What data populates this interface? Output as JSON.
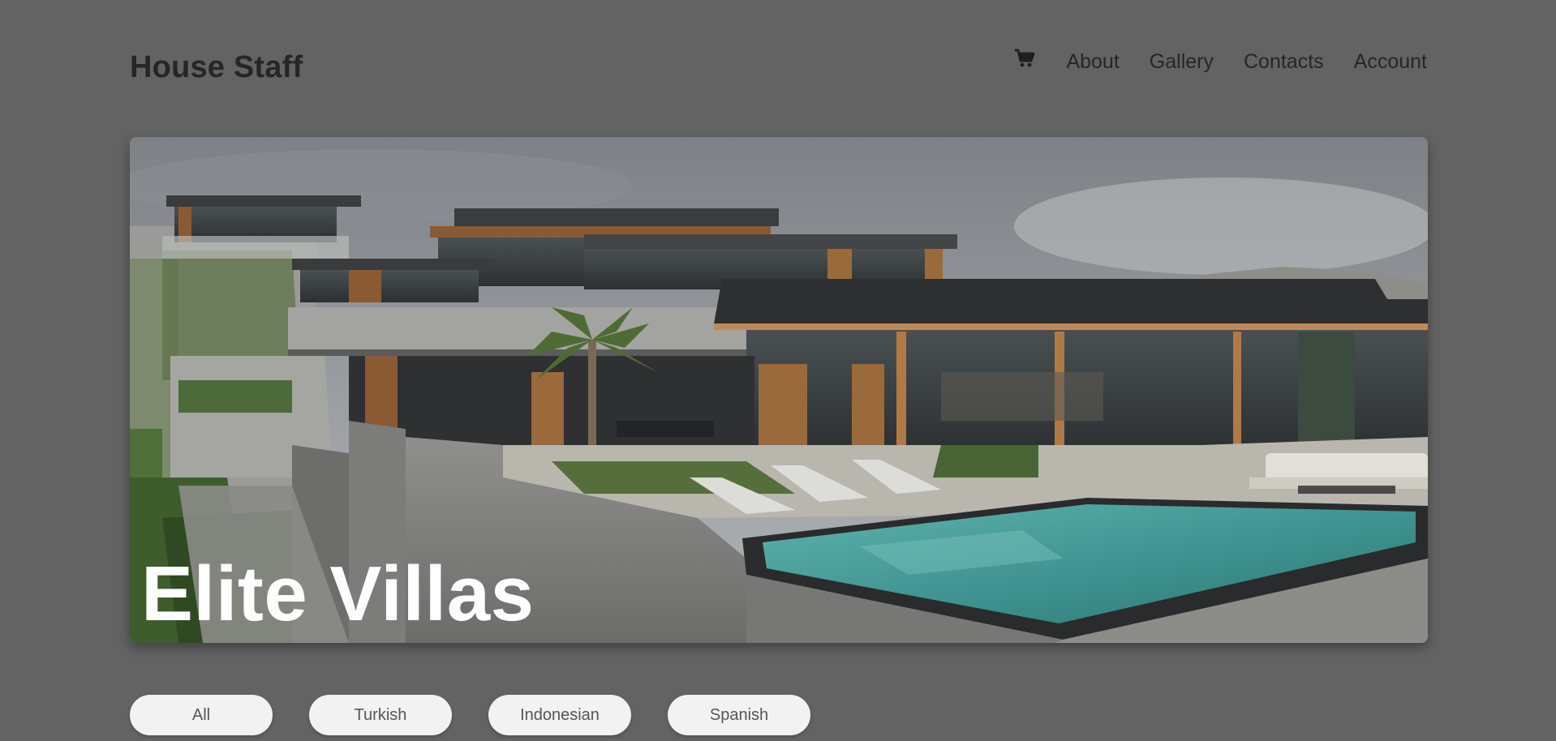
{
  "header": {
    "brand": "House Staff",
    "cart_icon": "cart-icon",
    "nav": [
      "About",
      "Gallery",
      "Contacts",
      "Account"
    ]
  },
  "hero": {
    "title": "Elite Villas",
    "image_icon": "villa-photo"
  },
  "filters": [
    "All",
    "Turkish",
    "Indonesian",
    "Spanish"
  ],
  "colors": {
    "page_background": "#636363",
    "pill_background": "#f2f2f2",
    "text_dark": "#262626"
  }
}
